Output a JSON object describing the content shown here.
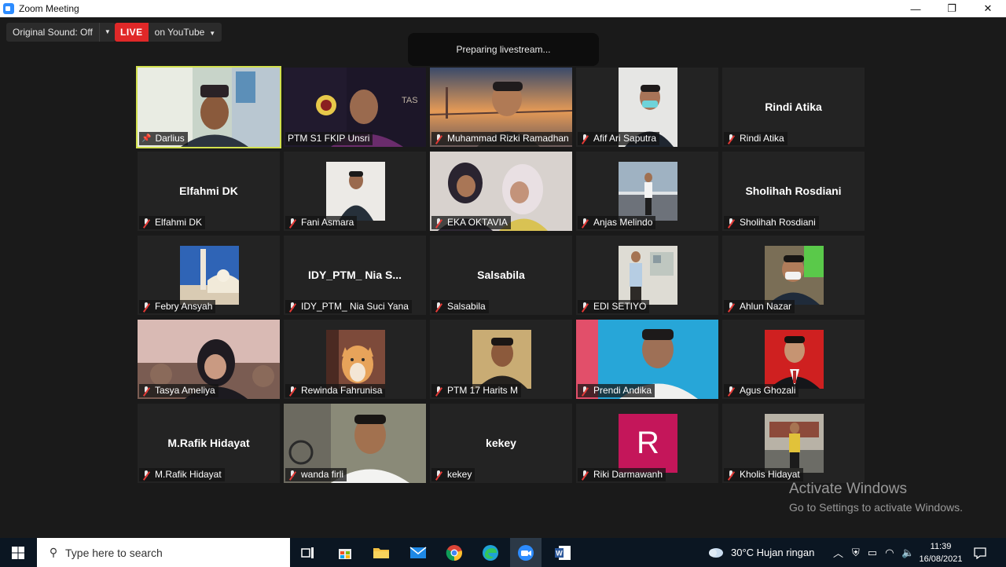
{
  "window": {
    "title": "Zoom Meeting",
    "controls": {
      "minimize": "—",
      "restore": "❐",
      "close": "✕"
    }
  },
  "toolbar": {
    "original_sound": "Original Sound: Off",
    "live_badge": "LIVE",
    "live_target": "on YouTube"
  },
  "toast": "Preparing livestream...",
  "participants": [
    {
      "name": "Darlius",
      "display": "video",
      "active": true,
      "pinned": true
    },
    {
      "name": "PTM S1 FKIP Unsri",
      "display": "video"
    },
    {
      "name": "Muhammad Rizki Ramadhan",
      "display": "video"
    },
    {
      "name": "Afif Ari Saputra",
      "display": "video"
    },
    {
      "name": "Rindi Atika",
      "display": "name",
      "center": "Rindi Atika"
    },
    {
      "name": "Elfahmi DK",
      "display": "name",
      "center": "Elfahmi DK"
    },
    {
      "name": "Fani Asmara",
      "display": "video"
    },
    {
      "name": "EKA OKTAVIA",
      "display": "video"
    },
    {
      "name": "Anjas Melindo",
      "display": "video"
    },
    {
      "name": "Sholihah Rosdiani",
      "display": "name",
      "center": "Sholihah Rosdiani"
    },
    {
      "name": "Febry Ansyah",
      "display": "video"
    },
    {
      "name": "IDY_PTM_ Nia Suci Yana",
      "display": "name",
      "center": "IDY_PTM_ Nia S..."
    },
    {
      "name": "Salsabila",
      "display": "name",
      "center": "Salsabila"
    },
    {
      "name": "EDI SETIYO",
      "display": "video"
    },
    {
      "name": "Ahlun Nazar",
      "display": "video"
    },
    {
      "name": "Tasya Ameliya",
      "display": "video"
    },
    {
      "name": "Rewinda Fahrunisa",
      "display": "video"
    },
    {
      "name": "PTM 17 Harits M",
      "display": "video"
    },
    {
      "name": "Prendi Andika",
      "display": "video"
    },
    {
      "name": "Agus Ghozali",
      "display": "video"
    },
    {
      "name": "M.Rafik Hidayat",
      "display": "name",
      "center": "M.Rafik Hidayat"
    },
    {
      "name": "wanda firli",
      "display": "video"
    },
    {
      "name": "kekey",
      "display": "name",
      "center": "kekey"
    },
    {
      "name": "Riki Darmawanh",
      "display": "avatar",
      "avatar_letter": "R"
    },
    {
      "name": "Kholis Hidayat",
      "display": "video"
    }
  ],
  "watermark": {
    "line1": "Activate Windows",
    "line2": "Go to Settings to activate Windows."
  },
  "taskbar": {
    "search_placeholder": "Type here to search",
    "weather": "30°C  Hujan ringan",
    "time": "11:39",
    "date": "16/08/2021"
  }
}
